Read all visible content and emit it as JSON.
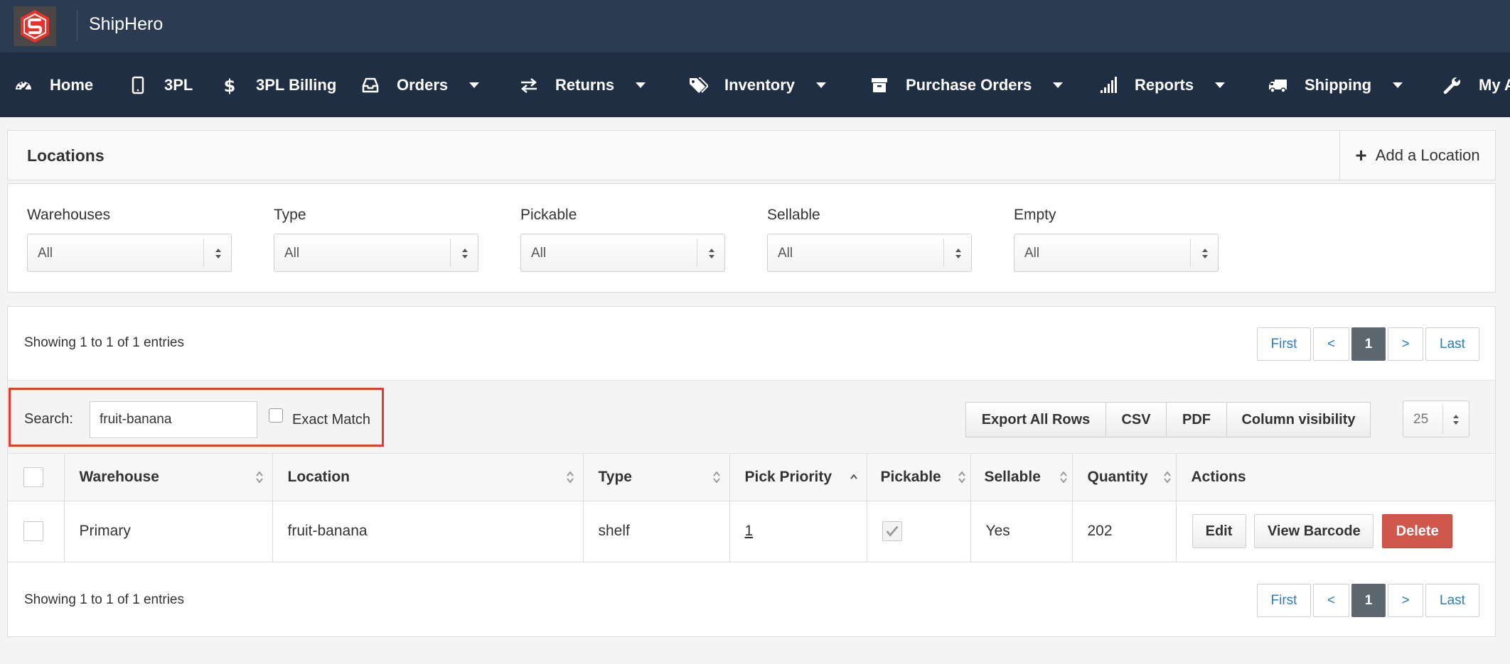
{
  "app": {
    "brand": "ShipHero"
  },
  "nav": [
    {
      "label": "Home",
      "icon": "dashboard-icon",
      "caret": false
    },
    {
      "label": "3PL",
      "icon": "tablet-icon",
      "caret": false
    },
    {
      "label": "3PL Billing",
      "icon": "dollar-icon",
      "caret": false
    },
    {
      "label": "Orders",
      "icon": "inbox-icon",
      "caret": true
    },
    {
      "label": "Returns",
      "icon": "exchange-icon",
      "caret": true
    },
    {
      "label": "Inventory",
      "icon": "tags-icon",
      "caret": true
    },
    {
      "label": "Purchase Orders",
      "icon": "archive-icon",
      "caret": true
    },
    {
      "label": "Reports",
      "icon": "signal-icon",
      "caret": true
    },
    {
      "label": "Shipping",
      "icon": "truck-icon",
      "caret": true
    },
    {
      "label": "My A",
      "icon": "wrench-icon",
      "caret": false
    }
  ],
  "panel": {
    "title": "Locations",
    "add_label": "Add a Location"
  },
  "filters": [
    {
      "label": "Warehouses",
      "value": "All"
    },
    {
      "label": "Type",
      "value": "All"
    },
    {
      "label": "Pickable",
      "value": "All"
    },
    {
      "label": "Sellable",
      "value": "All"
    },
    {
      "label": "Empty",
      "value": "All"
    }
  ],
  "info": {
    "top": "Showing 1 to 1 of 1 entries",
    "bottom": "Showing 1 to 1 of 1 entries"
  },
  "pager": {
    "first": "First",
    "prev": "<",
    "current": "1",
    "next": ">",
    "last": "Last"
  },
  "search": {
    "label": "Search:",
    "value": "fruit-banana",
    "exact_label": "Exact Match"
  },
  "toolbar": {
    "export_all": "Export All Rows",
    "csv": "CSV",
    "pdf": "PDF",
    "colvis": "Column visibility",
    "page_length": "25"
  },
  "columns": [
    "Warehouse",
    "Location",
    "Type",
    "Pick Priority",
    "Pickable",
    "Sellable",
    "Quantity",
    "Actions"
  ],
  "rows": [
    {
      "warehouse": "Primary",
      "location": "fruit-banana",
      "type": "shelf",
      "pick_priority": "1",
      "sellable": "Yes",
      "quantity": "202"
    }
  ],
  "actions": {
    "edit": "Edit",
    "barcode": "View Barcode",
    "delete": "Delete"
  }
}
